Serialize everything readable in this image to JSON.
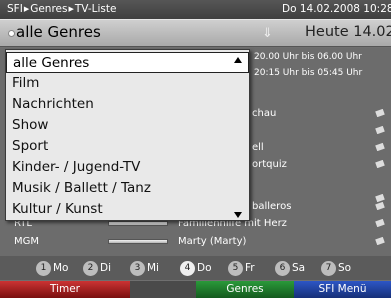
{
  "header": {
    "crumbs": [
      "SFI",
      "Genres",
      "TV-Liste"
    ],
    "datetime": "Do 14.02.2008  10:28"
  },
  "filter": {
    "value": "alle Genres",
    "heute": "Heute 14.02"
  },
  "timeline": {
    "line1": "20.00 Uhr bis 06.00 Uhr",
    "line2": "20:15 Uhr bis 05:45 Uhr"
  },
  "rows": [
    {
      "channel": "",
      "program": "chau"
    },
    {
      "channel": "",
      "program": ""
    },
    {
      "channel": "",
      "program": "ell"
    },
    {
      "channel": "",
      "program": "ortquiz"
    },
    {
      "channel": "",
      "program": ""
    },
    {
      "channel": "",
      "program": "balleros"
    },
    {
      "channel": "RTL",
      "program": "Familienhilfe mit Herz"
    },
    {
      "channel": "MGM",
      "program": "Marty (Marty)"
    }
  ],
  "dropdown": {
    "items": [
      "alle Genres",
      "Film",
      "Nachrichten",
      "Show",
      "Sport",
      "Kinder- / Jugend-TV",
      "Musik / Ballett / Tanz",
      "Kultur / Kunst"
    ],
    "selected_index": 0
  },
  "days": [
    {
      "num": "1",
      "label": "Mo"
    },
    {
      "num": "2",
      "label": "Di"
    },
    {
      "num": "3",
      "label": "Mi"
    },
    {
      "num": "4",
      "label": "Do"
    },
    {
      "num": "5",
      "label": "Fr"
    },
    {
      "num": "6",
      "label": "Sa"
    },
    {
      "num": "7",
      "label": "So"
    }
  ],
  "function_bar": {
    "red": "Timer",
    "yellow": "",
    "green": "Genres",
    "blue": "SFI Menü"
  },
  "colors": {
    "red": "#b52020",
    "green": "#1f7a2c",
    "blue": "#2342a0",
    "dropdown_bg": "#e9e9e9"
  }
}
